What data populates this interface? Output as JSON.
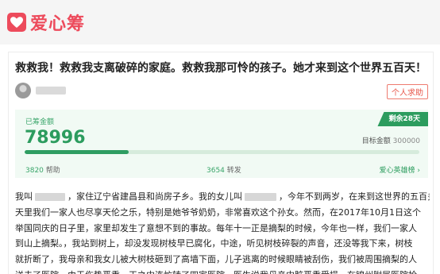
{
  "brand": {
    "name": "爱心筹",
    "color": "#ed4b5c"
  },
  "header": {
    "logo_icon": "heart-logo-icon"
  },
  "campaign": {
    "title": "救救我！救救我支离破碎的家庭。救救我那可怜的孩子。她才来到这个世界五百天！",
    "badge": "个人求助",
    "author_avatar": "avatar"
  },
  "fund": {
    "label": "已筹金额",
    "amount": "78996",
    "days_left": "剩余28天",
    "target_label": "目标金额",
    "target_amount": "300000",
    "progress": 0.263,
    "helps_count": "3820",
    "helps_label": "帮助",
    "shares_count": "3654",
    "shares_label": "转发",
    "love_link": "爱心英雄榜",
    "love_link_arrow": "›",
    "accent_color": "#2c9c5e"
  },
  "story": {
    "line1_a": "我叫",
    "line1_b": "，家住辽宁省建昌县和尚房子乡。我的女儿叫",
    "line1_c": "，今年不到两岁，在来到这世界的五百多",
    "line2": "天里我们一家人也尽享天伦之乐，特别是她爷爷奶奶，非常喜欢这个孙女。然而，在2017年10月1日这个",
    "line3": "举国同庆的日子里，家里却发生了意想不到的事故。每年十一正是摘梨的时候，今年也一样，我们一家人",
    "line4": "到山上摘梨。，我站到树上，却没发现树枝早已腐化，中途，听见树枝碎裂的声音，还没等我下来，树枝",
    "line5": "就折断了，我母亲和我女儿被大树枝砸到了高墙下面，儿子逃离的时候眼睛被刮伤，我们被周围摘梨的人",
    "line6": "送去了医院。由于伤势严重一天之内连忙转了四家医院，医生说我母亲内脏严重受损，在锦州附属医院抢"
  }
}
